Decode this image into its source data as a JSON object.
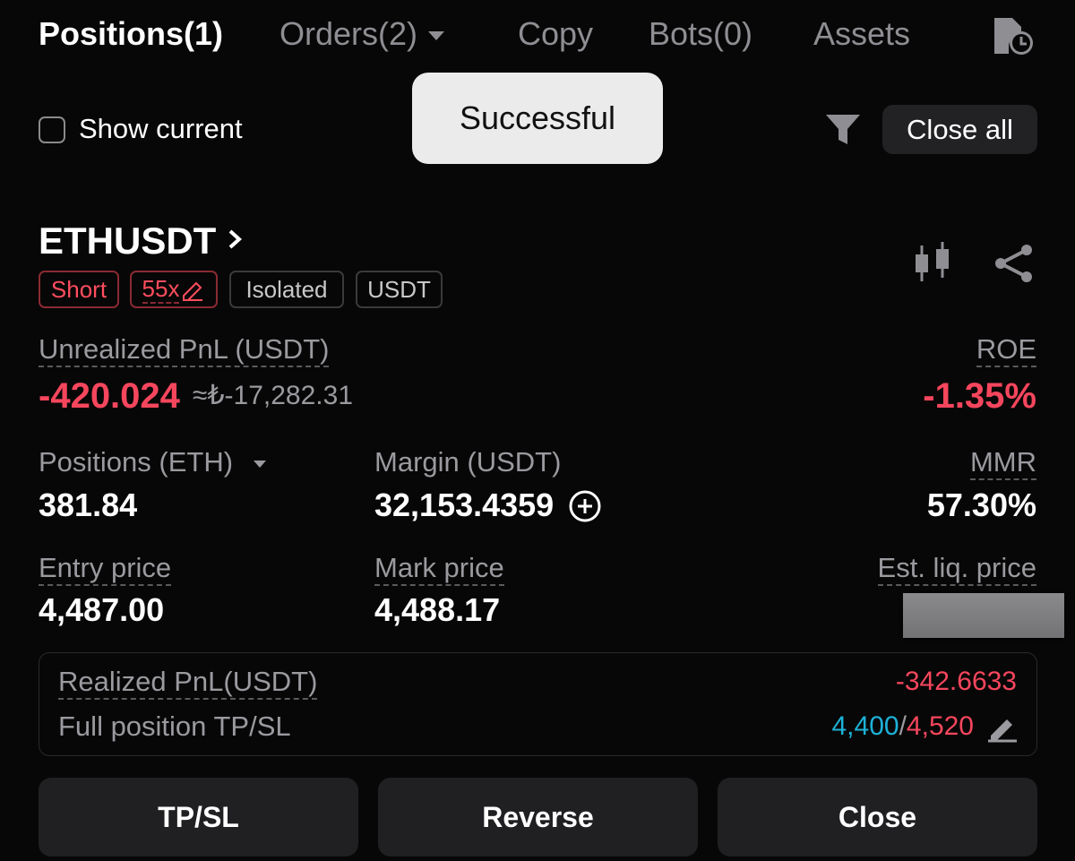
{
  "tabs": [
    {
      "label": "Positions(1)",
      "active": true
    },
    {
      "label": "Orders(2)",
      "active": false
    },
    {
      "label": "Copy",
      "active": false
    },
    {
      "label": "Bots(0)",
      "active": false
    },
    {
      "label": "Assets",
      "active": false
    }
  ],
  "toast": {
    "text": "Successful"
  },
  "toolbar": {
    "show_current_label": "Show current",
    "show_current_checked": false,
    "close_all_label": "Close all"
  },
  "position": {
    "symbol": "ETHUSDT",
    "tags": {
      "side": "Short",
      "leverage": "55x",
      "margin_mode": "Isolated",
      "settle": "USDT"
    },
    "unrealized_label": "Unrealized PnL (USDT)",
    "unrealized_value": "-420.024",
    "unrealized_approx": "≈₺-17,282.31",
    "roe_label": "ROE",
    "roe_value": "-1.35%",
    "size_label": "Positions (ETH)",
    "size_value": "381.84",
    "margin_label": "Margin (USDT)",
    "margin_value": "32,153.4359",
    "mmr_label": "MMR",
    "mmr_value": "57.30%",
    "entry_label": "Entry price",
    "entry_value": "4,487.00",
    "mark_label": "Mark price",
    "mark_value": "4,488.17",
    "liq_label": "Est. liq. price",
    "realized_label": "Realized PnL(USDT)",
    "realized_value": "-342.6633",
    "tpsl_label": "Full position TP/SL",
    "tp_value": "4,400",
    "tpsl_separator": "/",
    "sl_value": "4,520"
  },
  "actions": {
    "tpsl": "TP/SL",
    "reverse": "Reverse",
    "close": "Close"
  },
  "colors": {
    "red": "#f6465d",
    "tp_blue": "#1db1d8",
    "background": "#070707"
  }
}
